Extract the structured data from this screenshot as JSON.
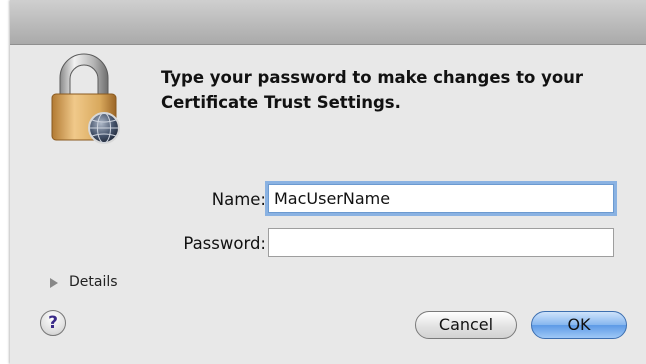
{
  "dialog": {
    "message": "Type your password to make changes to your Certificate Trust Settings."
  },
  "form": {
    "name_label": "Name:",
    "name_value": "MacUserName",
    "password_label": "Password:",
    "password_value": ""
  },
  "details": {
    "label": "Details"
  },
  "help": {
    "glyph": "?"
  },
  "buttons": {
    "cancel_label": "Cancel",
    "ok_label": "OK"
  },
  "icons": {
    "lock": "lock-icon",
    "globe": "globe-icon",
    "details_toggle": "disclosure-triangle-icon",
    "help": "help-icon"
  },
  "colors": {
    "focus_ring": "#8ab2e2",
    "default_button": "#5d9ae6",
    "help_glyph": "#3a2a88",
    "lock_body": "#d9a95d"
  }
}
